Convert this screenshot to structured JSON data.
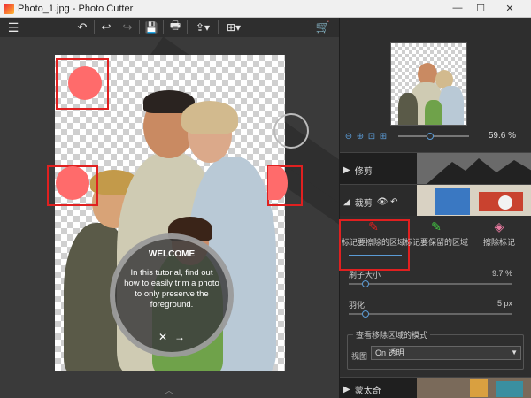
{
  "window": {
    "title": "Photo_1.jpg - Photo Cutter",
    "minimize": "—",
    "maximize": "☐",
    "close": "✕"
  },
  "toolbar": {
    "menu_icon": "☰",
    "rotate_icon": "↶",
    "undo_icon": "↩",
    "redo_icon": "↪",
    "save_icon": "💾",
    "print_icon": "🖶",
    "share_icon": "⇪▾",
    "export_icon": "⊞▾",
    "cart_icon": "🛒"
  },
  "tutorial": {
    "title": "WELCOME",
    "body": "In this tutorial, find out how to easily trim a photo to only preserve the foreground.",
    "close_icon": "✕",
    "next_icon": "→"
  },
  "canvas": {
    "expand_icon": "︿"
  },
  "zoom": {
    "value": "59.6 %",
    "zoom_in_icon": "⊕",
    "zoom_out_icon": "⊖",
    "fit_icon": "⊡",
    "actual_icon": "⊞"
  },
  "sections": {
    "crop_label": "修剪",
    "cutout_label": "裁剪",
    "cutout_icons": "👁 ↶",
    "background_label": "蒙太奇"
  },
  "tools": [
    {
      "label": "标记要擦除的区域",
      "icon": "✎",
      "color": "#e02020"
    },
    {
      "label": "标记要保留的区域",
      "icon": "✎",
      "color": "#43c943"
    },
    {
      "label": "擦除标记",
      "icon": "◈",
      "color": "#e87aa0"
    }
  ],
  "params": {
    "brush_label": "刷子大小",
    "brush_value": "9.7 %",
    "brush_level": 0.1,
    "feather_label": "羽化",
    "feather_value": "5 px",
    "feather_level": 0.1
  },
  "view": {
    "legend": "查看移除区域的模式",
    "label": "视图",
    "selected": "On 透明"
  }
}
